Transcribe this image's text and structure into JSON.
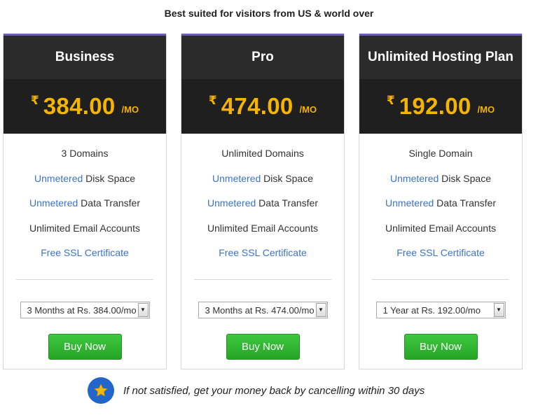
{
  "heading": "Best suited for visitors from US & world over",
  "plans": [
    {
      "name": "Business",
      "currency": "₹",
      "price": "384.00",
      "period": "/MO",
      "features": [
        {
          "highlight": "",
          "text": "3 Domains"
        },
        {
          "highlight": "Unmetered",
          "text": " Disk Space"
        },
        {
          "highlight": "Unmetered",
          "text": " Data Transfer"
        },
        {
          "highlight": "",
          "text": "Unlimited Email Accounts"
        },
        {
          "highlight": "Free SSL Certificate",
          "text": ""
        }
      ],
      "select_value": "3 Months at Rs. 384.00/mo",
      "buy_label": "Buy Now"
    },
    {
      "name": "Pro",
      "currency": "₹",
      "price": "474.00",
      "period": "/MO",
      "features": [
        {
          "highlight": "",
          "text": "Unlimited Domains"
        },
        {
          "highlight": "Unmetered",
          "text": " Disk Space"
        },
        {
          "highlight": "Unmetered",
          "text": " Data Transfer"
        },
        {
          "highlight": "",
          "text": "Unlimited Email Accounts"
        },
        {
          "highlight": "Free SSL Certificate",
          "text": ""
        }
      ],
      "select_value": "3 Months at Rs. 474.00/mo",
      "buy_label": "Buy Now"
    },
    {
      "name": "Unlimited Hosting Plan",
      "currency": "₹",
      "price": "192.00",
      "period": "/MO",
      "features": [
        {
          "highlight": "",
          "text": "Single Domain"
        },
        {
          "highlight": "Unmetered",
          "text": " Disk Space"
        },
        {
          "highlight": "Unmetered",
          "text": " Data Transfer"
        },
        {
          "highlight": "",
          "text": "Unlimited Email Accounts"
        },
        {
          "highlight": "Free SSL Certificate",
          "text": ""
        }
      ],
      "select_value": "1 Year at Rs. 192.00/mo",
      "buy_label": "Buy Now"
    }
  ],
  "guarantee": {
    "icon": "star-icon",
    "text": "If not satisfied, get your money back by cancelling within 30 days"
  },
  "colors": {
    "accent_gold": "#f4b400",
    "link_blue": "#3b73c8",
    "buy_green": "#2fb52f",
    "header_bg": "#2b2b2b",
    "badge_blue": "#2266cc"
  }
}
